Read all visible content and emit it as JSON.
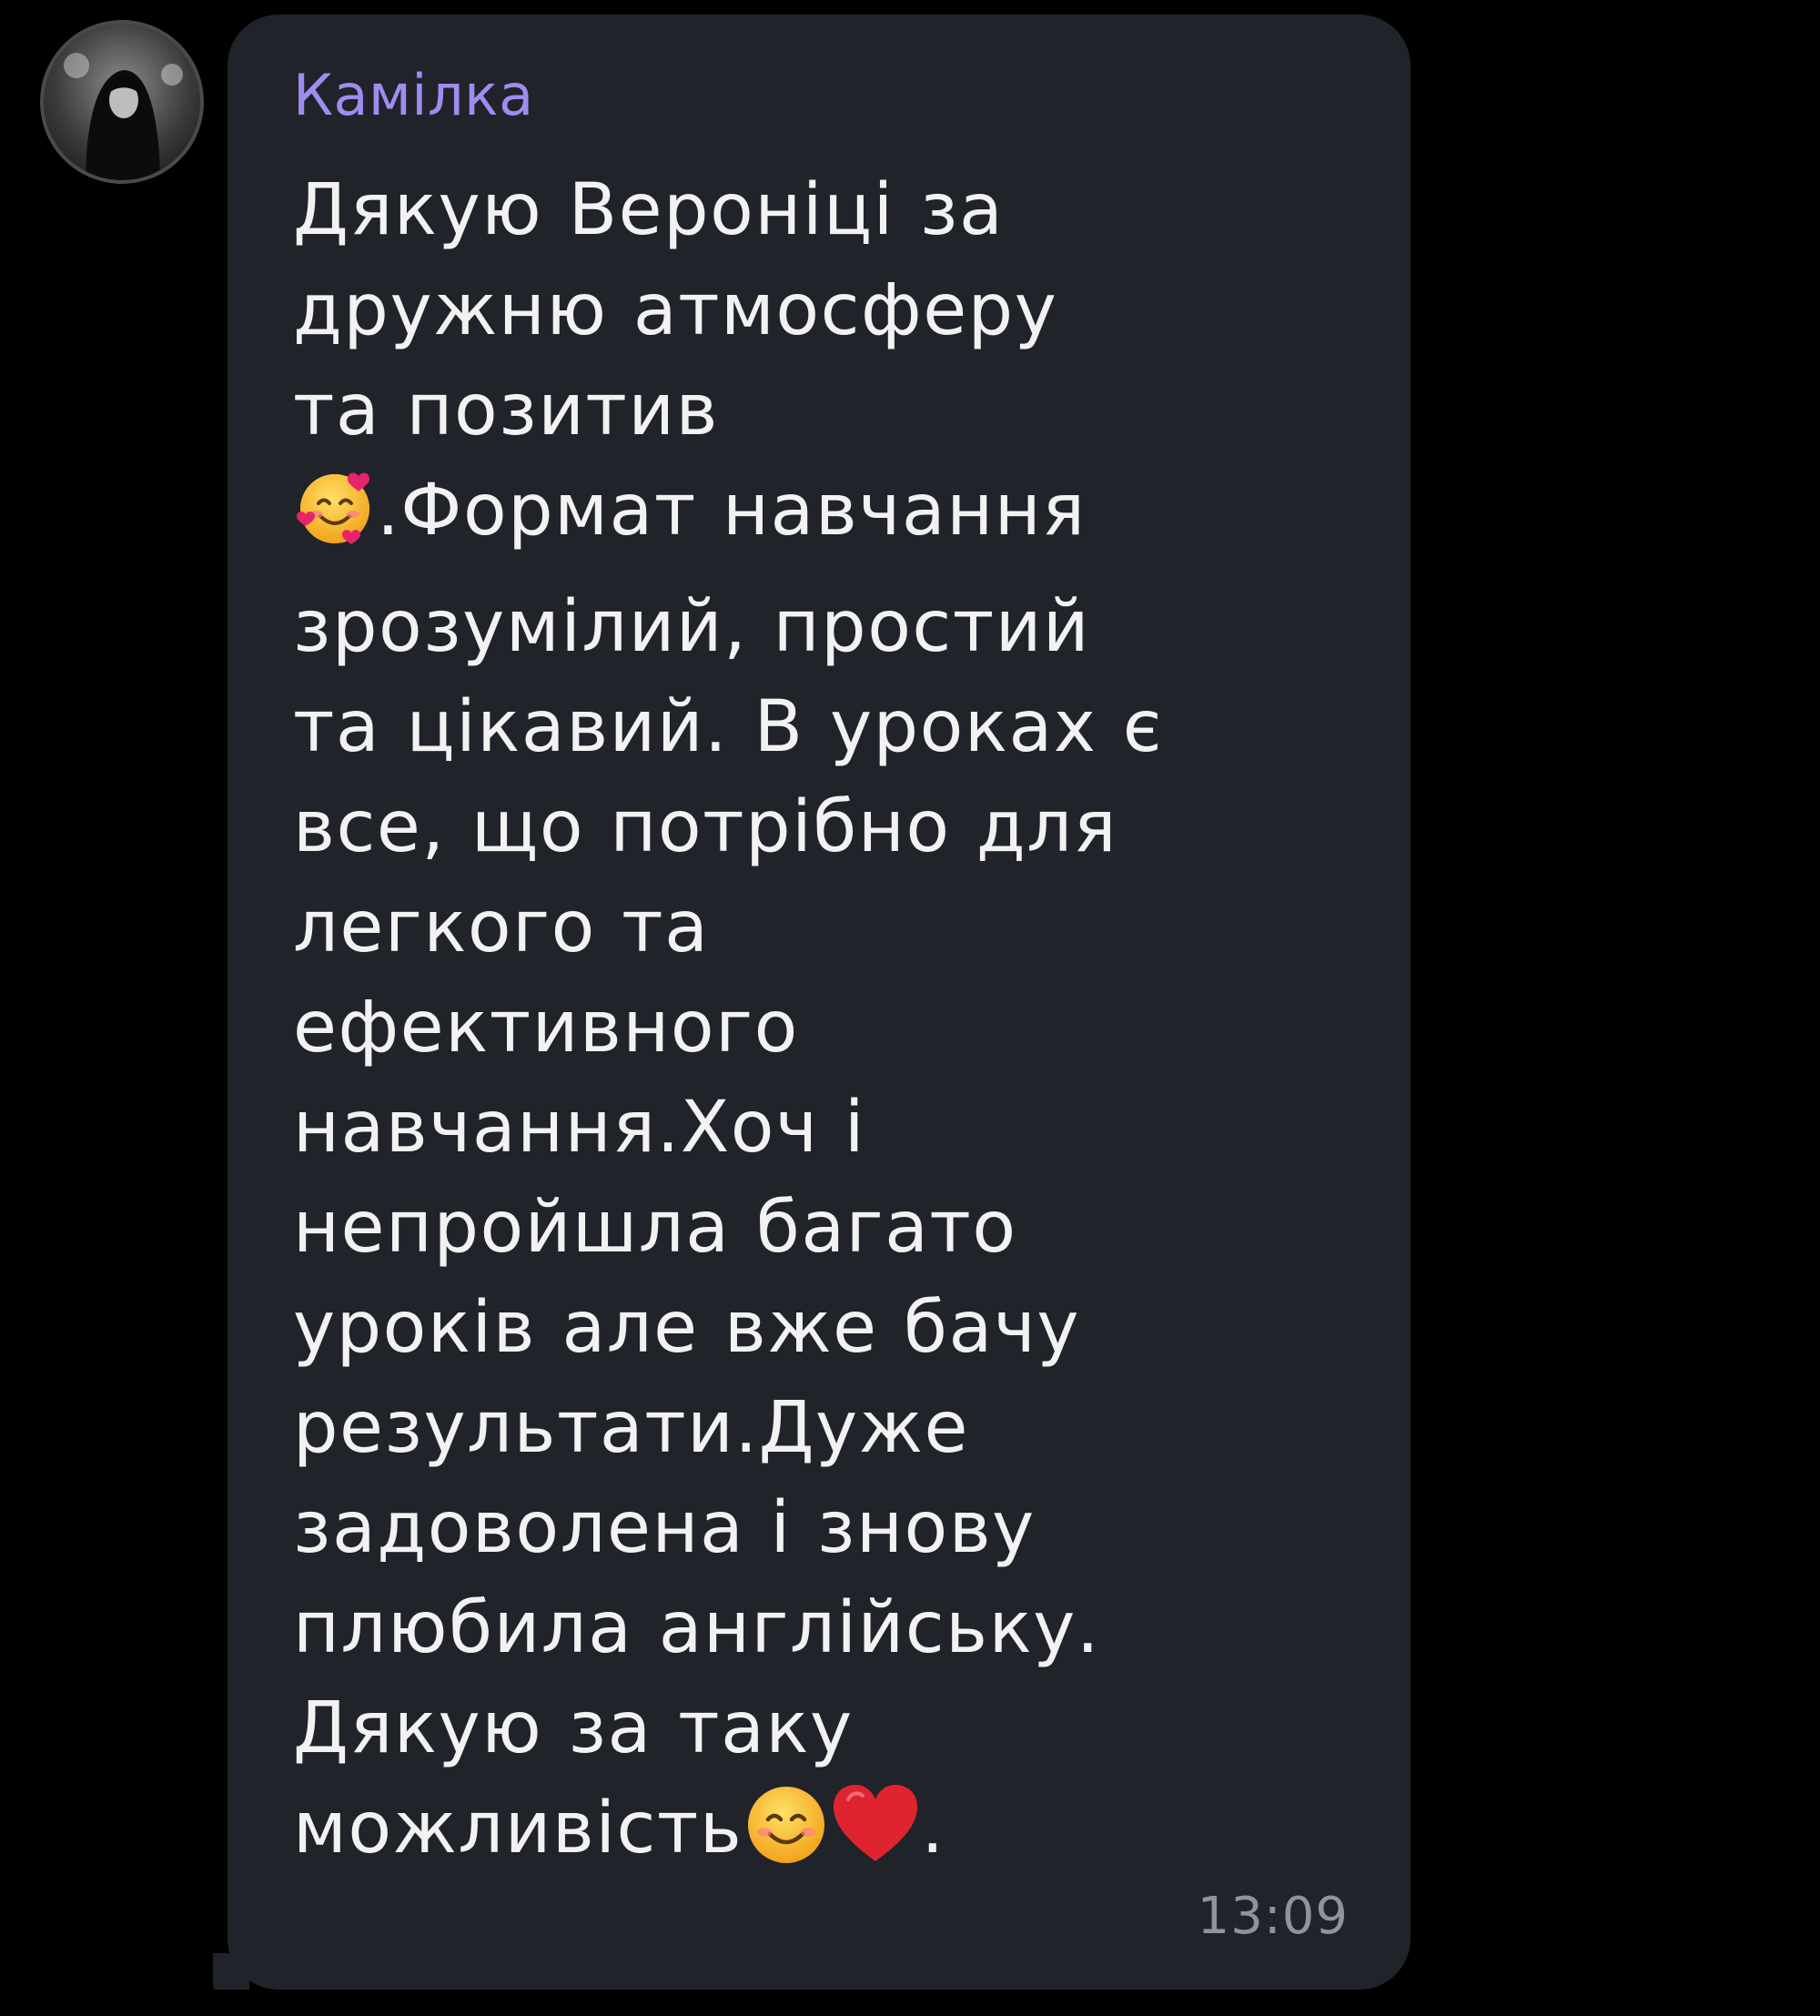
{
  "message": {
    "sender": "Камілка",
    "time": "13:09",
    "lines": [
      "Дякую Вероніці за",
      "дружню атмосферу",
      "та позитив",
      "{emoji_hearts}.Формат навчання",
      "зрозумілий, простий",
      "та цікавий. В уроках є",
      "все, що потрібно для",
      "легкого та",
      "ефективного",
      "навчання.Хоч і",
      "непройшла багато",
      "уроків але вже бачу",
      "результати.Дуже",
      "задоволена і знову",
      "плюбила англійську.",
      "Дякую за таку",
      "можливість{emoji_smile}{emoji_heart}."
    ],
    "line_1": "Дякую Вероніці за",
    "line_2": "дружню атмосферу",
    "line_3": "та позитив",
    "line_4_text": ".Формат навчання",
    "line_5": "зрозумілий, простий",
    "line_6": "та цікавий. В уроках є",
    "line_7": "все, що потрібно для",
    "line_8": "легкого та",
    "line_9": "ефективного",
    "line_10": "навчання.Хоч і",
    "line_11": "непройшла багато",
    "line_12": "уроків але вже бачу",
    "line_13": "результати.Дуже",
    "line_14": "задоволена і знову",
    "line_15": "плюбила англійську.",
    "line_16": "Дякую за таку",
    "line_17_text": "можливість",
    "line_17_tail": "."
  },
  "icons": {
    "avatar": "user-avatar-photo",
    "emoji_1": "smiling-face-with-hearts-emoji",
    "emoji_2": "smiling-face-emoji",
    "emoji_3": "red-heart-emoji"
  },
  "colors": {
    "bubble": "#202329",
    "sender": "#9f8cf0",
    "text": "#f2f2f2",
    "time": "#8e949c",
    "background": "#000000"
  }
}
